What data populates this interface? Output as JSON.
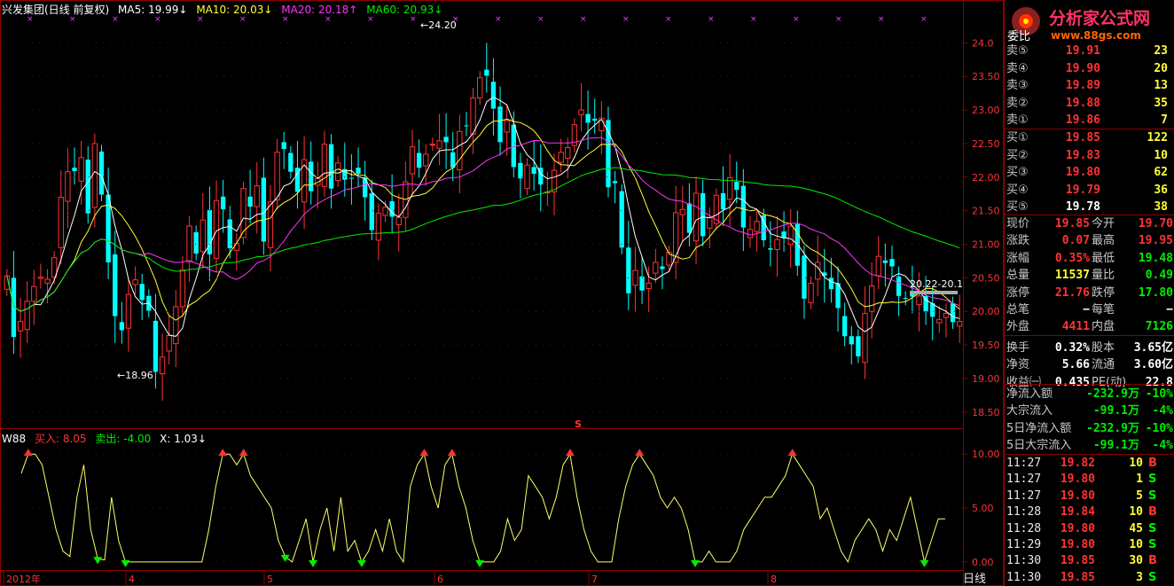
{
  "legend": {
    "title": "兴发集团(日线 前复权)",
    "ma5": "MA5: 19.99↓",
    "ma10": "MA10: 20.03↓",
    "ma20": "MA20: 20.18↑",
    "ma60": "MA60: 20.93↓"
  },
  "indicator_legend": {
    "name": "W88",
    "buy": "买入: 8.05",
    "sell": "卖出: -4.00",
    "x": "X: 1.03↓"
  },
  "labels": {
    "high_mark": "24.20",
    "low_mark": "18.96",
    "range_mark": "20.22-20.1",
    "s_marker": "S",
    "period": "日线"
  },
  "logo": {
    "name": "分析家公式网",
    "url": "www.88gs.com"
  },
  "orderbook": {
    "title": "委比",
    "sells": [
      {
        "label": "卖⑤",
        "price": "19.91",
        "vol": "23"
      },
      {
        "label": "卖④",
        "price": "19.90",
        "vol": "20"
      },
      {
        "label": "卖③",
        "price": "19.89",
        "vol": "13"
      },
      {
        "label": "卖②",
        "price": "19.88",
        "vol": "35"
      },
      {
        "label": "卖①",
        "price": "19.86",
        "vol": "7"
      }
    ],
    "buys": [
      {
        "label": "买①",
        "price": "19.85",
        "vol": "122"
      },
      {
        "label": "买②",
        "price": "19.83",
        "vol": "10"
      },
      {
        "label": "买③",
        "price": "19.80",
        "vol": "62"
      },
      {
        "label": "买④",
        "price": "19.79",
        "vol": "36"
      },
      {
        "label": "买⑤",
        "price": "19.78",
        "vol": "38"
      }
    ]
  },
  "quote": [
    {
      "k1": "现价",
      "v1": "19.85",
      "c1": "#ff3333",
      "k2": "今开",
      "v2": "19.70",
      "c2": "#ff3333"
    },
    {
      "k1": "涨跌",
      "v1": "0.07",
      "c1": "#ff3333",
      "k2": "最高",
      "v2": "19.95",
      "c2": "#ff3333"
    },
    {
      "k1": "涨幅",
      "v1": "0.35%",
      "c1": "#ff3333",
      "k2": "最低",
      "v2": "19.48",
      "c2": "#00ee00"
    },
    {
      "k1": "总量",
      "v1": "11537",
      "c1": "#ffff33",
      "k2": "量比",
      "v2": "0.49",
      "c2": "#00ee00"
    },
    {
      "k1": "涨停",
      "v1": "21.76",
      "c1": "#ff3333",
      "k2": "跌停",
      "v2": "17.80",
      "c2": "#00ee00"
    },
    {
      "k1": "总笔",
      "v1": "−",
      "c1": "#ffffff",
      "k2": "每笔",
      "v2": "−",
      "c2": "#ffffff"
    },
    {
      "k1": "外盘",
      "v1": "4411",
      "c1": "#ff3333",
      "k2": "内盘",
      "v2": "7126",
      "c2": "#00ee00"
    },
    {
      "k1": "换手",
      "v1": "0.32%",
      "c1": "#ffffff",
      "k2": "股本",
      "v2": "3.65亿",
      "c2": "#ffffff"
    },
    {
      "k1": "净资",
      "v1": "5.66",
      "c1": "#ffffff",
      "k2": "流通",
      "v2": "3.60亿",
      "c2": "#ffffff"
    },
    {
      "k1": "收益㈠",
      "v1": "0.435",
      "c1": "#ffffff",
      "k2": "PE(动)",
      "v2": "22.8",
      "c2": "#ffffff"
    }
  ],
  "flows": [
    {
      "k": "净流入额",
      "v": "-232.9万",
      "p": "-10%"
    },
    {
      "k": "大宗流入",
      "v": "-99.1万",
      "p": "-4%"
    },
    {
      "k": "5日净流入额",
      "v": "-232.9万",
      "p": "-10%"
    },
    {
      "k": "5日大宗流入",
      "v": "-99.1万",
      "p": "-4%"
    }
  ],
  "ticks": [
    {
      "t": "11:27",
      "p": "19.82",
      "pc": "#ff3333",
      "v": "10",
      "bs": "B",
      "bc": "#ff3333"
    },
    {
      "t": "11:27",
      "p": "19.80",
      "pc": "#ff3333",
      "v": "1",
      "bs": "S",
      "bc": "#00ee00"
    },
    {
      "t": "11:27",
      "p": "19.80",
      "pc": "#ff3333",
      "v": "5",
      "bs": "S",
      "bc": "#00ee00"
    },
    {
      "t": "11:28",
      "p": "19.84",
      "pc": "#ff3333",
      "v": "10",
      "bs": "B",
      "bc": "#ff3333"
    },
    {
      "t": "11:28",
      "p": "19.80",
      "pc": "#ff3333",
      "v": "45",
      "bs": "S",
      "bc": "#00ee00"
    },
    {
      "t": "11:29",
      "p": "19.80",
      "pc": "#ff3333",
      "v": "10",
      "bs": "S",
      "bc": "#00ee00"
    },
    {
      "t": "11:30",
      "p": "19.85",
      "pc": "#ff3333",
      "v": "30",
      "bs": "B",
      "bc": "#ff3333"
    },
    {
      "t": "11:30",
      "p": "19.85",
      "pc": "#ff3333",
      "v": "3",
      "bs": "S",
      "bc": "#00ee00"
    }
  ],
  "colors": {
    "up": "#ff3333",
    "down": "#00ffff",
    "ma5": "#ffffff",
    "ma10": "#ffff33",
    "ma20": "#ff33ff",
    "ma60": "#00ee00",
    "grid": "#8b0000"
  },
  "chart_data": {
    "type": "candlestick",
    "y_axis_ticks": [
      "24.0",
      "23.50",
      "23.00",
      "22.50",
      "22.00",
      "21.50",
      "21.00",
      "20.50",
      "20.00",
      "19.50",
      "19.00",
      "18.50"
    ],
    "ylim": [
      18.3,
      24.4
    ],
    "x_axis_labels": [
      "2012年",
      "4",
      "5",
      "6",
      "7",
      "8"
    ],
    "indicator": {
      "name": "W88",
      "y_axis_ticks": [
        "10.00",
        "5.00",
        "0.00"
      ],
      "ylim": [
        -0.5,
        11
      ],
      "values": [
        8.2,
        10,
        10,
        9,
        6,
        3,
        1,
        0.5,
        6,
        9,
        3,
        0.3,
        0.2,
        6,
        2,
        0,
        0,
        0,
        0,
        0,
        0,
        0,
        0,
        0,
        0,
        0,
        0,
        3,
        7,
        10,
        10,
        9,
        10,
        8,
        7,
        6,
        5,
        2,
        0.5,
        0,
        2,
        4,
        0,
        3,
        5,
        1,
        6,
        1,
        2,
        0,
        1,
        3,
        1,
        4,
        1,
        0,
        7,
        9,
        10,
        7,
        5,
        9,
        10,
        7,
        5,
        2,
        0,
        0,
        0,
        1,
        4,
        2,
        3,
        8,
        7,
        6,
        4,
        6,
        9,
        10,
        6,
        3,
        1,
        0,
        0,
        0,
        4,
        7,
        9,
        10,
        9,
        8,
        6,
        5,
        6,
        5,
        3,
        0,
        0,
        1,
        0,
        0,
        0,
        1,
        3,
        4,
        5,
        6,
        6,
        7,
        8,
        10,
        9,
        8,
        7,
        4,
        5,
        3,
        1,
        0,
        2,
        3,
        4,
        3,
        1,
        3,
        2,
        4,
        6,
        3,
        0,
        2,
        4,
        4
      ]
    },
    "close": [
      20.53,
      19.62,
      19.85,
      20.15,
      20.37,
      20.51,
      20.48,
      20.8,
      21.7,
      22.08,
      22.09,
      22.29,
      21.46,
      22.5,
      21.74,
      20.73,
      19.93,
      19.72,
      20.25,
      20.47,
      20.17,
      20.01,
      19.1,
      19.32,
      19.64,
      20.07,
      20.62,
      21.27,
      20.86,
      21.36,
      20.85,
      21.65,
      21.52,
      20.94,
      21.01,
      21.83,
      21.56,
      21.87,
      21.04,
      21.63,
      22.37,
      22.42,
      22.08,
      21.78,
      22.26,
      21.79,
      21.98,
      22.49,
      21.83,
      22.21,
      21.96,
      21.99,
      22.05,
      21.7,
      21.21,
      21.46,
      21.55,
      21.41,
      21.4,
      21.93,
      22.45,
      22.14,
      22.34,
      22.49,
      22.54,
      22.52,
      22.14,
      22.68,
      22.76,
      23.18,
      23.48,
      23.51,
      23.02,
      22.52,
      22.84,
      22.15,
      21.98,
      22.18,
      22.05,
      21.89,
      21.78,
      22.1,
      22.37,
      22.44,
      22.78,
      23.0,
      22.81,
      22.84,
      22.88,
      21.85,
      21.91,
      20.95,
      20.27,
      20.61,
      20.31,
      20.42,
      20.73,
      20.63,
      20.88,
      21.47,
      21.52,
      21.17,
      21.76,
      21.12,
      21.4,
      21.73,
      21.52,
      21.99,
      21.81,
      21.25,
      21.22,
      21.34,
      21.06,
      20.92,
      21.07,
      21.09,
      21.27,
      20.68,
      20.19,
      20.42,
      20.73,
      20.53,
      20.33,
      20.05,
      19.63,
      19.51,
      19.33,
      19.97,
      20.38,
      20.82,
      20.72,
      20.67,
      20.23,
      20.19,
      20.22,
      20.23,
      20.0,
      19.92,
      19.88,
      19.97,
      19.84,
      19.85
    ]
  }
}
